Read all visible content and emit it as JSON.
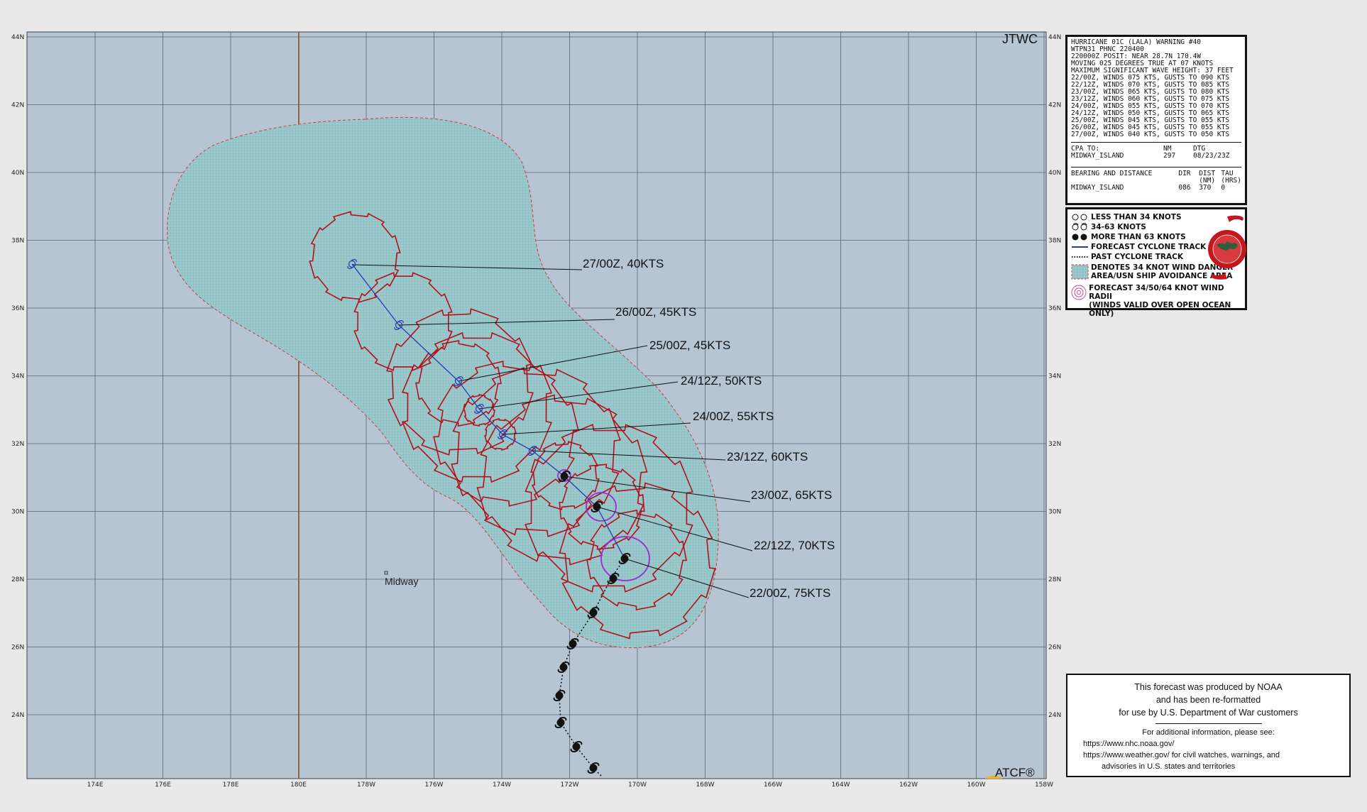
{
  "map": {
    "corner_label": "JTWC",
    "atcf_label": "ATCF®",
    "lat_labels": [
      "44N",
      "42N",
      "40N",
      "38N",
      "36N",
      "34N",
      "32N",
      "30N",
      "28N",
      "26N",
      "24N"
    ],
    "lon_labels": [
      "174E",
      "176E",
      "178E",
      "180E",
      "178W",
      "176W",
      "174W",
      "172W",
      "170W",
      "168W",
      "166W",
      "164W",
      "162W",
      "160W",
      "158W"
    ],
    "place": "Midway",
    "colors": {
      "ocean": "#b7c5d3",
      "danger_area": "#93c6c8",
      "radii": "#b3101c",
      "track": "#2a38b4",
      "wind64": "#9a2bd6",
      "dateline": "#8a5a2c"
    },
    "forecast_labels": [
      {
        "id": "f27",
        "text": "27/00Z,  40KTS"
      },
      {
        "id": "f26",
        "text": "26/00Z,  45KTS"
      },
      {
        "id": "f25",
        "text": "25/00Z,  45KTS"
      },
      {
        "id": "f2412",
        "text": "24/12Z,  50KTS"
      },
      {
        "id": "f24",
        "text": "24/00Z,  55KTS"
      },
      {
        "id": "f2312",
        "text": "23/12Z,  60KTS"
      },
      {
        "id": "f23",
        "text": "23/00Z,  65KTS"
      },
      {
        "id": "f2212",
        "text": "22/12Z,  70KTS"
      },
      {
        "id": "f22",
        "text": "22/00Z,  75KTS"
      }
    ]
  },
  "warning": {
    "lines": [
      "HURRICANE 01C (LALA) WARNING #40",
      "WTPN31 PHNC 220400",
      "220000Z POSIT: NEAR 28.7N 170.4W",
      "MOVING 025 DEGREES TRUE AT 07 KNOTS",
      "MAXIMUM SIGNIFICANT WAVE HEIGHT: 37 FEET",
      "22/00Z, WINDS 075 KTS, GUSTS TO 090 KTS",
      "22/12Z, WINDS 070 KTS, GUSTS TO 085 KTS",
      "23/00Z, WINDS 065 KTS, GUSTS TO 080 KTS",
      "23/12Z, WINDS 060 KTS, GUSTS TO 075 KTS",
      "24/00Z, WINDS 055 KTS, GUSTS TO 070 KTS",
      "24/12Z, WINDS 050 KTS, GUSTS TO 065 KTS",
      "25/00Z, WINDS 045 KTS, GUSTS TO 055 KTS",
      "26/00Z, WINDS 045 KTS, GUSTS TO 055 KTS",
      "27/00Z, WINDS 040 KTS, GUSTS TO 050 KTS"
    ],
    "cpa": {
      "header": [
        "CPA TO:",
        "NM",
        "DTG"
      ],
      "row": [
        "MIDWAY_ISLAND",
        "297",
        "08/23/23Z"
      ]
    },
    "bearing": {
      "header": [
        "BEARING AND DISTANCE",
        "DIR",
        "DIST",
        "TAU"
      ],
      "units": [
        "",
        "",
        "(NM)",
        "(HRS)"
      ],
      "row": [
        "MIDWAY_ISLAND",
        "086",
        "370",
        "0"
      ]
    }
  },
  "legend": {
    "items": [
      "LESS THAN 34 KNOTS",
      "34-63 KNOTS",
      "MORE THAN 63 KNOTS",
      "FORECAST CYCLONE TRACK",
      "PAST CYCLONE TRACK",
      "DENOTES 34 KNOT WIND DANGER",
      "AREA/USN SHIP AVOIDANCE AREA",
      "FORECAST 34/50/64 KNOT WIND RADII",
      "(WINDS VALID OVER OPEN OCEAN ONLY)"
    ]
  },
  "note": {
    "line1": "This forecast was produced by NOAA",
    "line2": "and has been re-formatted",
    "line3": "for use by U.S. Department of War customers",
    "info": "For additional information, please see:",
    "url1": "https://www.nhc.noaa.gov/",
    "url2": "https://www.weather.gov/",
    "url2_rest": "for civil watches, warnings, and",
    "line_last": "advisories in U.S. states and territories"
  }
}
